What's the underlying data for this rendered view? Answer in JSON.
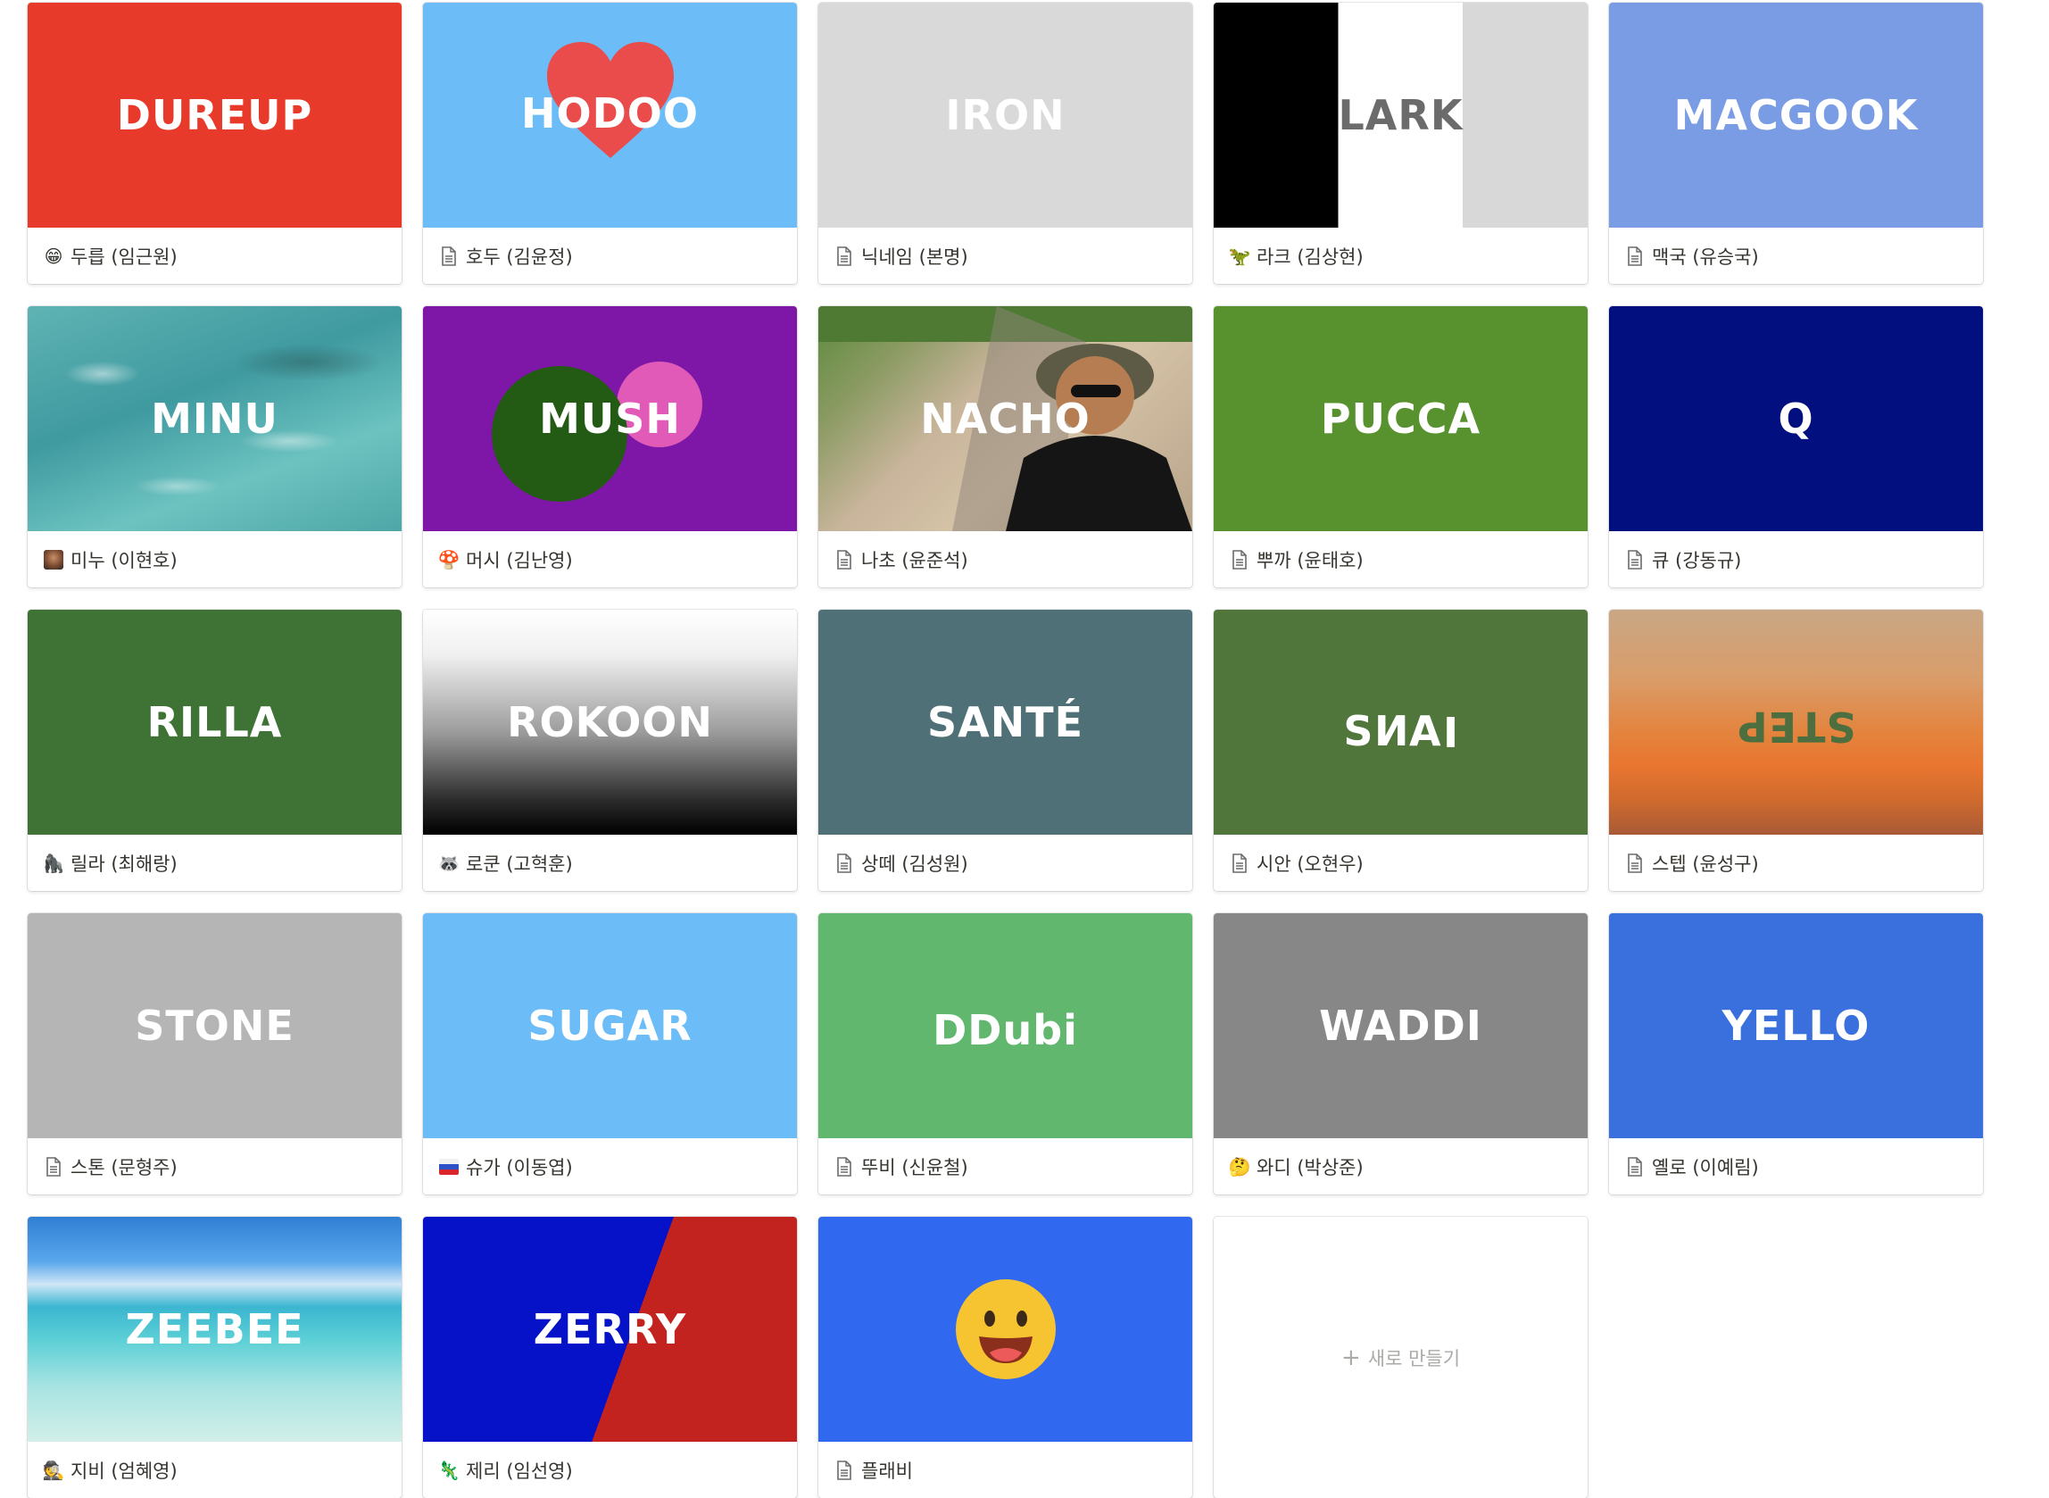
{
  "gallery": {
    "cards": [
      {
        "cover_text": "DUREUP",
        "icon": "grinning-emoji",
        "title": "두릅 (임근원)"
      },
      {
        "cover_text": "HODOO",
        "icon": "page-icon",
        "title": "호두 (김윤정)"
      },
      {
        "cover_text": "IRON",
        "icon": "page-icon",
        "title": "닉네임 (본명)"
      },
      {
        "cover_text": "LARK",
        "icon": "dinosaur-emoji",
        "title": "라크 (김상현)"
      },
      {
        "cover_text": "MACGOOK",
        "icon": "page-icon",
        "title": "맥국 (유승국)"
      },
      {
        "cover_text": "MINU",
        "icon": "avatar-photo",
        "title": "미누  (이현호)"
      },
      {
        "cover_text": "MUSH",
        "icon": "mushroom-emoji",
        "title": "머시 (김난영)"
      },
      {
        "cover_text": "NACHO",
        "icon": "page-icon",
        "title": "나초 (윤준석)"
      },
      {
        "cover_text": "PUCCA",
        "icon": "page-icon",
        "title": "뿌까 (윤태호)"
      },
      {
        "cover_text": "Q",
        "icon": "page-icon",
        "title": "큐 (강동규)"
      },
      {
        "cover_text": "RILLA",
        "icon": "gorilla-emoji",
        "title": "릴라 (최해랑)"
      },
      {
        "cover_text": "ROKOON",
        "icon": "raccoon-emoji",
        "title": "로쿤 (고혁훈)"
      },
      {
        "cover_text": "SANTÉ",
        "icon": "page-icon",
        "title": "상떼 (김성원)"
      },
      {
        "cover_text": "SIAN",
        "icon": "page-icon",
        "title": "시안 (오현우)"
      },
      {
        "cover_text": "STEP",
        "icon": "page-icon",
        "title": "스텝 (윤성구)"
      },
      {
        "cover_text": "STONE",
        "icon": "page-icon",
        "title": "스톤 (문형주)"
      },
      {
        "cover_text": "SUGAR",
        "icon": "flag-emoji",
        "title": "슈가 (이동엽)"
      },
      {
        "cover_text": "DDubi",
        "icon": "page-icon",
        "title": "뚜비 (신윤철)"
      },
      {
        "cover_text": "WADDI",
        "icon": "thinking-emoji",
        "title": "와디 (박상준)"
      },
      {
        "cover_text": "YELLO",
        "icon": "page-icon",
        "title": "옐로 (이예림)"
      },
      {
        "cover_text": "ZEEBEE",
        "icon": "detective-emoji",
        "title": "지비 (엄혜영)"
      },
      {
        "cover_text": "ZERRY",
        "icon": "lizard-emoji",
        "title": "제리 (임선영)"
      },
      {
        "cover_text": "",
        "icon": "page-icon",
        "title": "플래비"
      }
    ],
    "new_card": {
      "plus": "+",
      "label": "새로 만들기"
    }
  },
  "emoji": {
    "grinning": "😁",
    "dinosaur": "🦖",
    "mushroom": "🍄",
    "gorilla": "🦍",
    "raccoon": "🦝",
    "flag": "🇷🇺",
    "thinking": "🤔",
    "detective": "🕵",
    "lizard": "🦎",
    "big_face": "😛"
  }
}
